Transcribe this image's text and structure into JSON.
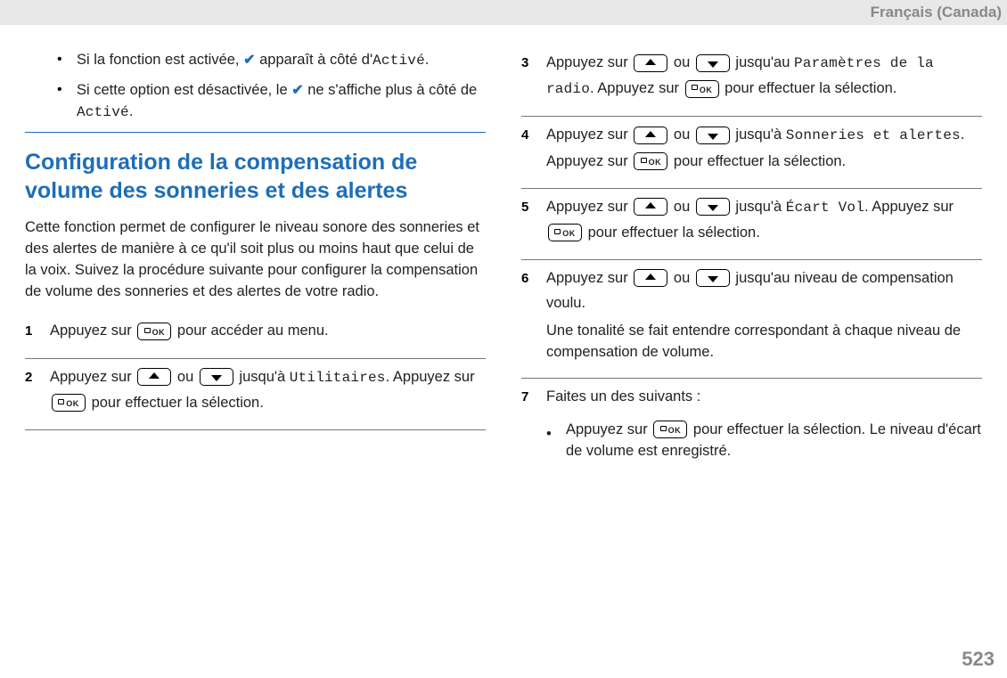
{
  "header": {
    "language": "Français (Canada)"
  },
  "page_number": "523",
  "col1": {
    "bullets": [
      {
        "p1": "Si la fonction est activée, ",
        "p2": " apparaît à côté d'",
        "mono": "Activé",
        "p3": "."
      },
      {
        "p1": "Si cette option est désactivée, le ",
        "p2": " ne s'affiche plus à côté de ",
        "mono": "Activé",
        "p3": "."
      }
    ],
    "heading": "Configuration de la compensation de volume des sonneries et des alertes",
    "intro": "Cette fonction permet de configurer le niveau sonore des sonneries et des alertes de manière à ce qu'il soit plus ou moins haut que celui de la voix. Suivez la procédure suivante pour configurer la compensation de volume des sonneries et des alertes de votre radio.",
    "steps": {
      "s1": {
        "num": "1",
        "t1": "Appuyez sur ",
        "t2": " pour accéder au menu."
      },
      "s2": {
        "num": "2",
        "t1": "Appuyez sur ",
        "ou": " ou ",
        "t2": " jusqu'à ",
        "mono": "Utilitaires",
        "t3": ". Appuyez sur ",
        "t4": " pour effectuer la sélection."
      }
    }
  },
  "col2": {
    "steps": {
      "s3": {
        "num": "3",
        "t1": "Appuyez sur ",
        "ou": " ou ",
        "t2": " jusqu'au ",
        "mono": "Paramètres de la radio",
        "t3": ". Appuyez sur ",
        "t4": " pour effectuer la sélection."
      },
      "s4": {
        "num": "4",
        "t1": "Appuyez sur ",
        "ou": " ou ",
        "t2": " jusqu'à ",
        "mono": "Sonneries et alertes",
        "t3": ". Appuyez sur ",
        "t4": " pour effectuer la sélection."
      },
      "s5": {
        "num": "5",
        "t1": "Appuyez sur ",
        "ou": " ou ",
        "t2": " jusqu'à ",
        "mono": "Écart Vol",
        "t3": ". Appuyez sur ",
        "t4": " pour effectuer la sélection."
      },
      "s6": {
        "num": "6",
        "t1": "Appuyez sur ",
        "ou": " ou ",
        "t2": " jusqu'au niveau de compensation voulu.",
        "extra": "Une tonalité se fait entendre correspondant à chaque niveau de compensation de volume."
      },
      "s7": {
        "num": "7",
        "lead": "Faites un des suivants :",
        "b1a": "Appuyez sur ",
        "b1b": " pour effectuer la sélection. Le niveau d'écart de volume est enregistré."
      }
    }
  },
  "icons": {
    "ok_label": "OK"
  }
}
